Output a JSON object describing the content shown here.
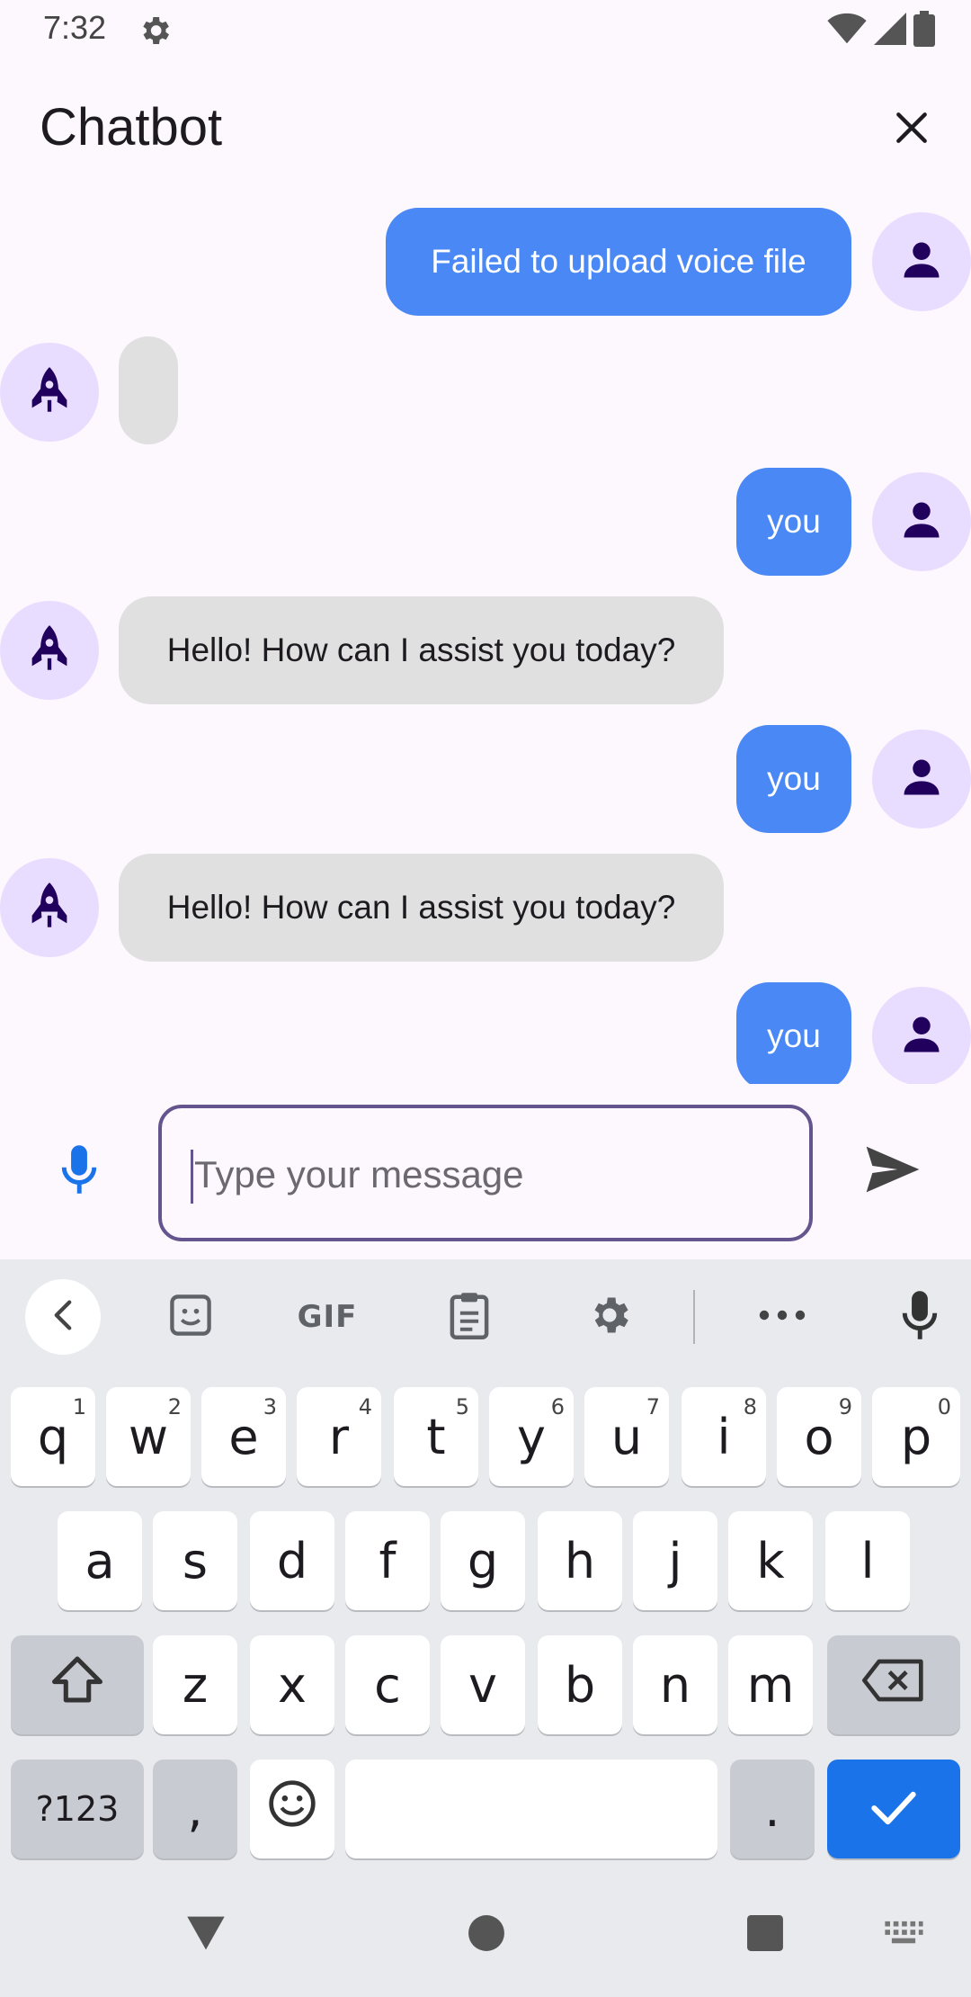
{
  "status_bar": {
    "time": "7:32",
    "icons": [
      "settings-icon",
      "wifi-icon",
      "signal-icon",
      "battery-icon"
    ]
  },
  "app_bar": {
    "title": "Chatbot",
    "close_icon": "close-icon"
  },
  "colors": {
    "user_bubble": "#4a88f5",
    "bot_bubble": "#e0e0e0",
    "avatar_bg": "#e9ddff",
    "avatar_icon": "#21005d",
    "input_border": "#65558f",
    "enter_key": "#1a73e8",
    "mic_icon": "#1a73e8"
  },
  "messages": [
    {
      "sender": "user",
      "text": "Failed to upload voice file"
    },
    {
      "sender": "bot",
      "text": ""
    },
    {
      "sender": "user",
      "text": "you"
    },
    {
      "sender": "bot",
      "text": "Hello! How can I assist you today?"
    },
    {
      "sender": "user",
      "text": "you"
    },
    {
      "sender": "bot",
      "text": "Hello! How can I assist you today?"
    },
    {
      "sender": "user",
      "text": "you"
    }
  ],
  "composer": {
    "placeholder": "Type your message",
    "value": ""
  },
  "keyboard": {
    "toolbar": {
      "gif_label": "GIF"
    },
    "row1": [
      {
        "key": "q",
        "hint": "1"
      },
      {
        "key": "w",
        "hint": "2"
      },
      {
        "key": "e",
        "hint": "3"
      },
      {
        "key": "r",
        "hint": "4"
      },
      {
        "key": "t",
        "hint": "5"
      },
      {
        "key": "y",
        "hint": "6"
      },
      {
        "key": "u",
        "hint": "7"
      },
      {
        "key": "i",
        "hint": "8"
      },
      {
        "key": "o",
        "hint": "9"
      },
      {
        "key": "p",
        "hint": "0"
      }
    ],
    "row2": [
      "a",
      "s",
      "d",
      "f",
      "g",
      "h",
      "j",
      "k",
      "l"
    ],
    "row3": [
      "z",
      "x",
      "c",
      "v",
      "b",
      "n",
      "m"
    ],
    "row4": {
      "symbols": "?123",
      "comma": ",",
      "period": "."
    }
  }
}
